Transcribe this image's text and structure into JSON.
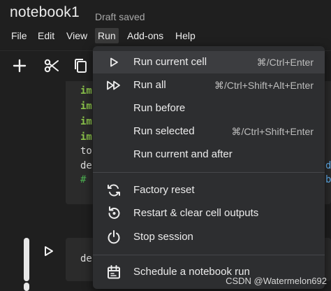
{
  "app": {
    "title": "notebook1",
    "status": "Draft saved"
  },
  "menubar": {
    "items": [
      "File",
      "Edit",
      "View",
      "Run",
      "Add-ons",
      "Help"
    ],
    "active": "Run"
  },
  "code": {
    "lines": [
      "im",
      "im",
      "im",
      "im",
      "to",
      "de",
      "#"
    ],
    "right_chars": [
      "d",
      "b"
    ]
  },
  "cell2": {
    "text": "de"
  },
  "run_menu": {
    "items": [
      {
        "label": "Run current cell",
        "shortcut": "⌘/Ctrl+Enter",
        "icon": "play-icon"
      },
      {
        "label": "Run all",
        "shortcut": "⌘/Ctrl+Shift+Alt+Enter",
        "icon": "fast-forward-icon"
      },
      {
        "label": "Run before",
        "shortcut": "",
        "icon": ""
      },
      {
        "label": "Run selected",
        "shortcut": "⌘/Ctrl+Shift+Enter",
        "icon": ""
      },
      {
        "label": "Run current and after",
        "shortcut": "",
        "icon": ""
      },
      {
        "label": "Factory reset",
        "shortcut": "",
        "icon": "refresh-icon"
      },
      {
        "label": "Restart & clear cell outputs",
        "shortcut": "",
        "icon": "restart-icon"
      },
      {
        "label": "Stop session",
        "shortcut": "",
        "icon": "power-icon"
      },
      {
        "label": "Schedule a notebook run",
        "shortcut": "",
        "icon": "calendar-icon"
      }
    ]
  },
  "watermark": "CSDN @Watermelon692",
  "colors": {
    "accent_green": "#8bc34a",
    "menu_bg": "#2d2e30",
    "page_bg": "#1f1f1f"
  }
}
